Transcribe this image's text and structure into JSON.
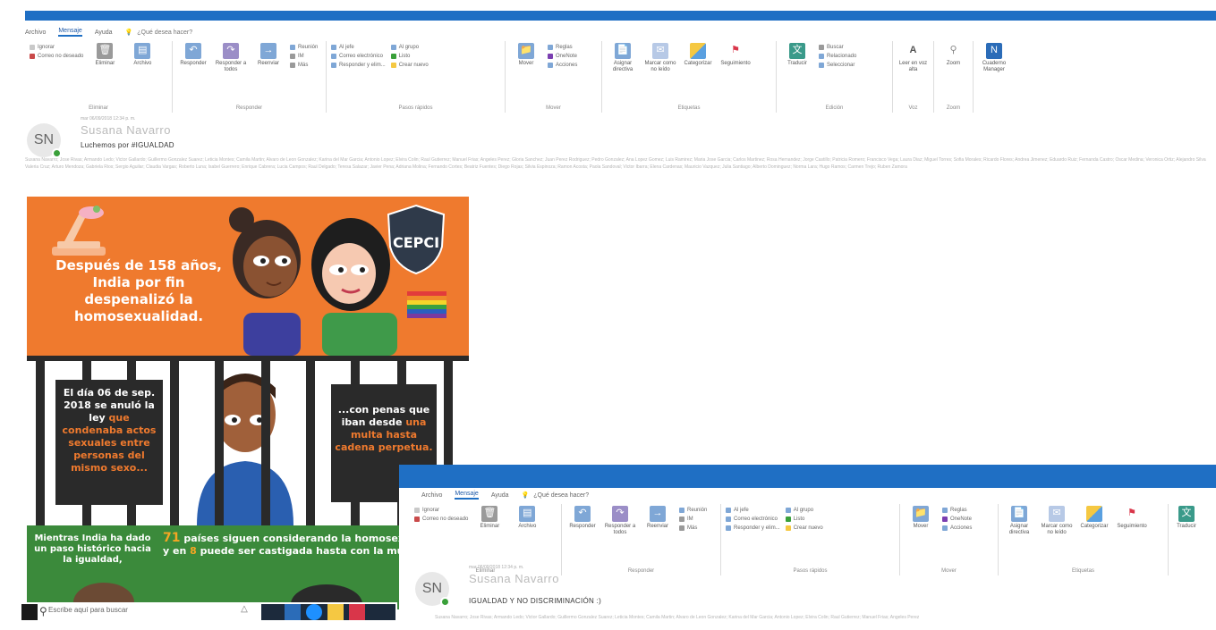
{
  "win1": {
    "tabs": [
      "Archivo",
      "Mensaje",
      "Ayuda"
    ],
    "active_tab": "Mensaje",
    "tell_me": "¿Qué desea hacer?",
    "groups": {
      "eliminar": {
        "label": "Eliminar",
        "ignorar": "Ignorar",
        "correo_no_deseado": "Correo no deseado",
        "eliminar_btn": "Eliminar",
        "archivo_btn": "Archivo"
      },
      "responder": {
        "label": "Responder",
        "responder_btn": "Responder",
        "responder_todos": "Responder a todos",
        "reenviar": "Reenviar",
        "reunion": "Reunión",
        "im": "IM",
        "mas": "Más"
      },
      "pasos_rapidos": {
        "label": "Pasos rápidos",
        "items": [
          "Al jefe",
          "Correo electrónico",
          "Responder y elim...",
          "Al grupo",
          "Listo",
          "Crear nuevo"
        ]
      },
      "mover": {
        "label": "Mover",
        "mover_btn": "Mover",
        "reglas": "Reglas",
        "onenote": "OneNote",
        "acciones": "Acciones"
      },
      "etiquetas": {
        "label": "Etiquetas",
        "asignar_directiva": "Asignar directiva",
        "marcar_no_leido": "Marcar como no leído",
        "categorizar": "Categorizar",
        "seguimiento": "Seguimiento"
      },
      "edicion": {
        "label": "Edición",
        "traducir": "Traducir",
        "buscar": "Buscar",
        "relacionado": "Relacionado",
        "seleccionar": "Seleccionar"
      },
      "voz": {
        "label": "Voz",
        "leer_en_voz_alta": "Leer en voz alta"
      },
      "zoom": {
        "label": "Zoom",
        "zoom_btn": "Zoom"
      },
      "onenote_manager": {
        "label": "Cuaderno Manager"
      }
    },
    "header": {
      "avatar_initials": "SN",
      "sender": "Susana Navarro",
      "subject": "Luchemos por #IGUALDAD",
      "meta": "mar 06/09/2018 12:34 p. m."
    },
    "recipients": [
      "Susana Navarro; Jose Rivas; Armando Ledo; Victor Gallardo; Guillermo Gonzalez Suarez; Leticia Montes; Camila Martin; Alvaro de Leon Gonzalez; Karina del Mar Garcia; Antonio Lopez; Elvira Colin; Raul Gutierrez; Manuel Frias; Angeles Perez; Gloria Sanchez; Juan Perez Rodriguez; Pedro Gonzalez; Ana Lopez Gomez; Luis Ramirez; Maria Jose Garcia; Carlos Martinez; Rosa Hernandez; Jorge Castillo; Patricia Romero; Francisco Vega; Laura Diaz; Miguel Torres; Sofia Morales; Ricardo Flores; Andrea Jimenez; Eduardo Ruiz; Fernanda Castro; Oscar Medina; Veronica Ortiz; Alejandro Silva; Daniela Reyes; Hector Navarro; Monica Herrera",
      "Valeria Cruz; Arturo Mendoza; Gabriela Rios; Sergio Aguilar; Claudia Vargas; Roberto Luna; Isabel Guerrero; Enrique Cabrera; Lucia Campos; Raul Delgado; Teresa Salazar; Javier Pena; Adriana Molina; Fernando Cortes; Beatriz Fuentes; Diego Rojas; Silvia Espinoza; Ramon Acosta; Paola Sandoval; Victor Ibarra; Elena Cardenas; Mauricio Vazquez; Julia Santiago; Alberto Dominguez; Norma Lara; Hugo Ramos; Carmen Trejo; Ruben Zamora"
    ]
  },
  "infographic": {
    "cepci": "CEPCI",
    "headline": "Después de 158 años, India por fin despenalizó la homosexualidad.",
    "left_panel_1": "El día 06 de sep. 2018 se anuló la ley ",
    "left_panel_hl": "que condenaba actos sexuales entre personas del mismo sexo...",
    "right_panel_1": "...con penas que iban desde ",
    "right_panel_hl": "una multa hasta cadena perpetua.",
    "bottom_left": "Mientras India ha dado un paso histórico hacia la igualdad,",
    "bottom_right_num": "71",
    "bottom_right_1": " países siguen considerando la homosexualidad un delito",
    "bottom_right_2": "y en ",
    "bottom_right_num2": "8",
    "bottom_right_3": " puede ser castigada hasta con la muerte."
  },
  "taskbar": {
    "search_placeholder": "Escribe aquí para buscar"
  },
  "win2": {
    "tabs": [
      "Archivo",
      "Mensaje",
      "Ayuda"
    ],
    "active_tab": "Mensaje",
    "tell_me": "¿Qué desea hacer?",
    "ignorar": "Ignorar",
    "correo_no_deseado": "Correo no deseado",
    "eliminar_btn": "Eliminar",
    "archivo_btn": "Archivo",
    "eliminar_label": "Eliminar",
    "responder_btn": "Responder",
    "responder_todos": "Responder a todos",
    "reenviar": "Reenviar",
    "reunion": "Reunión",
    "im": "IM",
    "mas": "Más",
    "responder_label": "Responder",
    "pasos_label": "Pasos rápidos",
    "pasos_items": [
      "Al jefe",
      "Correo electrónico",
      "Responder y elim...",
      "Al grupo",
      "Listo",
      "Crear nuevo"
    ],
    "mover_btn": "Mover",
    "reglas": "Reglas",
    "onenote": "OneNote",
    "acciones": "Acciones",
    "mover_label": "Mover",
    "asignar_directiva": "Asignar directiva",
    "marcar_no_leido": "Marcar como no leído",
    "categorizar": "Categorizar",
    "seguimiento": "Seguimiento",
    "etiquetas_label": "Etiquetas",
    "traducir": "Traducir",
    "avatar_initials": "SN",
    "sender": "Susana Navarro",
    "subject": "IGUALDAD Y NO DISCRIMINACIÓN :)",
    "meta": "mar 06/09/2018 12:34 p. m.",
    "recipients": "Susana Navarro; Jose Rivas; Armando Ledo; Victor Gallardo; Guillermo Gonzalez Suarez; Leticia Montes; Camila Martin; Alvaro de Leon Gonzalez; Karina del Mar Garcia; Antonio Lopez; Elvira Colin; Raul Gutierrez; Manuel Frias; Angeles Perez"
  },
  "colors": {
    "titlebar": "#1f6fc4",
    "infographic_orange": "#ef7a2e",
    "infographic_green": "#3b8a3b",
    "presence_green": "#3aa03a"
  }
}
